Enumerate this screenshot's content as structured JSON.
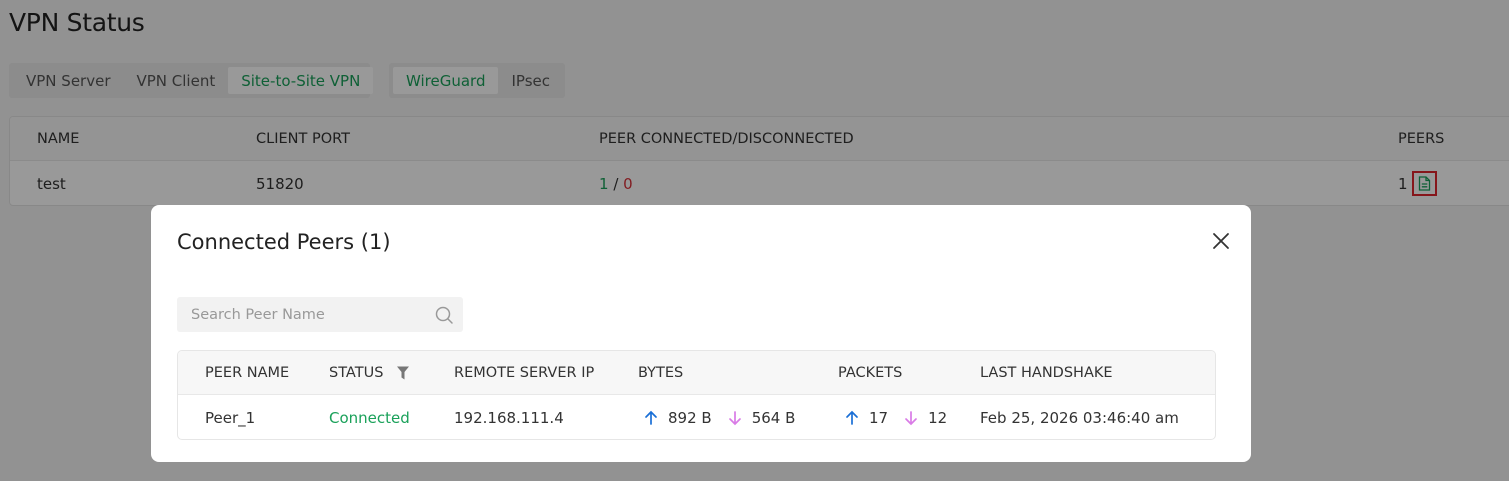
{
  "page": {
    "title": "VPN Status"
  },
  "tabs_primary": [
    {
      "label": "VPN Server",
      "active": false
    },
    {
      "label": "VPN Client",
      "active": false
    },
    {
      "label": "Site-to-Site VPN",
      "active": true
    }
  ],
  "tabs_secondary": [
    {
      "label": "WireGuard",
      "active": true
    },
    {
      "label": "IPsec",
      "active": false
    }
  ],
  "main_table": {
    "headers": {
      "name": "NAME",
      "client_port": "CLIENT PORT",
      "peer_conn": "PEER CONNECTED/DISCONNECTED",
      "peers": "PEERS"
    },
    "rows": [
      {
        "name": "test",
        "client_port": "51820",
        "connected": "1",
        "separator": " / ",
        "disconnected": "0",
        "peers": "1",
        "peers_icon": "document-icon"
      }
    ]
  },
  "modal": {
    "title": "Connected Peers (1)",
    "close_icon": "close-icon",
    "search": {
      "placeholder": "Search Peer Name",
      "value": "",
      "icon": "search-icon"
    },
    "table": {
      "headers": {
        "peer_name": "PEER NAME",
        "status": "STATUS",
        "remote_ip": "REMOTE SERVER IP",
        "bytes": "BYTES",
        "packets": "PACKETS",
        "last_handshake": "LAST HANDSHAKE"
      },
      "status_filter_icon": "filter-icon",
      "rows": [
        {
          "peer_name": "Peer_1",
          "status": "Connected",
          "remote_ip": "192.168.111.4",
          "bytes_up": "892 B",
          "bytes_down": "564 B",
          "packets_up": "17",
          "packets_down": "12",
          "last_handshake": "Feb 25, 2026 03:46:40 am"
        }
      ]
    }
  },
  "colors": {
    "accent_green": "#1aa15a",
    "error_red": "#d9313a",
    "upload_blue": "#1a6fd6",
    "download_pink": "#d97be6",
    "highlight_border": "#e0262e"
  }
}
